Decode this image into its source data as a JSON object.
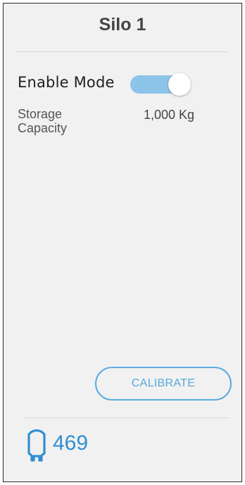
{
  "title": "Silo 1",
  "enable_mode": {
    "label": "Enable Mode",
    "state": "on",
    "accent_color": "#8cc4ea"
  },
  "storage": {
    "label": "Storage Capacity",
    "value": "1,000 Kg"
  },
  "calibrate_label": "CALIBRATE",
  "footer": {
    "icon": "silo-icon",
    "count": "469",
    "accent_color": "#2f8fd2"
  }
}
